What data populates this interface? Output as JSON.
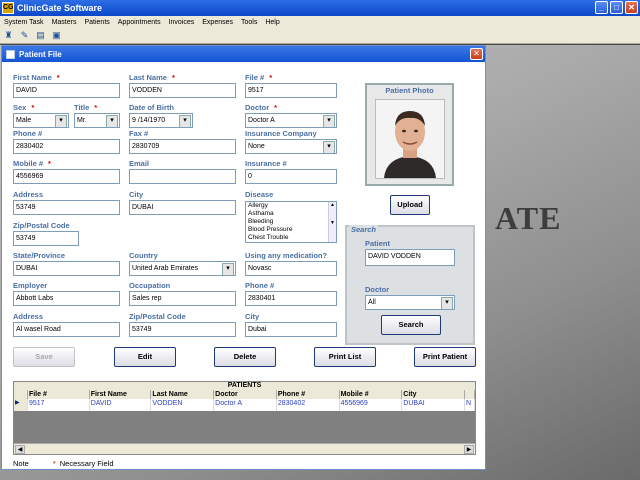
{
  "app": {
    "title": "ClinicGate Software",
    "icon_text": "CG"
  },
  "menus": [
    "System Task",
    "Masters",
    "Patients",
    "Appointments",
    "Invoices",
    "Expenses",
    "Tools",
    "Help"
  ],
  "desktop_text": "ATE",
  "form": {
    "title": "Patient File",
    "fields": {
      "first_name": {
        "label": "First Name",
        "value": "DAVID"
      },
      "last_name": {
        "label": "Last Name",
        "value": "VODDEN"
      },
      "file_no": {
        "label": "File #",
        "value": "9517"
      },
      "sex": {
        "label": "Sex",
        "value": "Male"
      },
      "title": {
        "label": "Title",
        "value": "Mr."
      },
      "dob": {
        "label": "Date of Birth",
        "value": "9 /14/1970"
      },
      "doctor": {
        "label": "Doctor",
        "value": "Doctor A"
      },
      "phone": {
        "label": "Phone #",
        "value": "2830402"
      },
      "fax": {
        "label": "Fax #",
        "value": "2830709"
      },
      "insurance_company": {
        "label": "Insurance Company",
        "value": "None"
      },
      "mobile": {
        "label": "Mobile #",
        "value": "4556969"
      },
      "email": {
        "label": "Email",
        "value": ""
      },
      "insurance_no": {
        "label": "Insurance #",
        "value": "0"
      },
      "address": {
        "label": "Address",
        "value": "53749"
      },
      "city": {
        "label": "City",
        "value": "DUBAI"
      },
      "disease": {
        "label": "Disease",
        "options": [
          "Allergy",
          "Asthama",
          "Bleeding",
          "Blood Pressure",
          "Chest Trouble"
        ]
      },
      "zip": {
        "label": "Zip/Postal Code",
        "value": "53749"
      },
      "state": {
        "label": "State/Province",
        "value": "DUBAI"
      },
      "country": {
        "label": "Country",
        "value": "United Arab Emirates"
      },
      "medication": {
        "label": "Using any medication?",
        "value": "Novasc"
      },
      "employer": {
        "label": "Employer",
        "value": "Abbott Labs"
      },
      "occupation": {
        "label": "Occupation",
        "value": "Sales rep"
      },
      "work_phone": {
        "label": "Phone #",
        "value": "2830401"
      },
      "work_address": {
        "label": "Address",
        "value": "Al wasel Road"
      },
      "work_zip": {
        "label": "Zip/Postal Code",
        "value": "53749"
      },
      "work_city": {
        "label": "City",
        "value": "Dubai"
      }
    },
    "photo_label": "Patient Photo",
    "upload_label": "Upload",
    "search": {
      "title": "Search",
      "patient_label": "Patient",
      "patient_value": "DAVID VODDEN",
      "doctor_label": "Doctor",
      "doctor_value": "All",
      "button": "Search"
    },
    "buttons": {
      "save": "Save",
      "edit": "Edit",
      "delete": "Delete",
      "print_list": "Print List",
      "print_patient": "Print Patient"
    },
    "grid": {
      "title": "PATIENTS",
      "columns": [
        "File #",
        "First Name",
        "Last Name",
        "Doctor",
        "Phone #",
        "Mobile #",
        "City",
        ""
      ],
      "row": [
        "9517",
        "DAVID",
        "VODDEN",
        "Doctor A",
        "2830402",
        "4556969",
        "DUBAI",
        "N"
      ]
    },
    "note_label": "Note",
    "note_star": "*",
    "note_text": "Necessary Field"
  }
}
